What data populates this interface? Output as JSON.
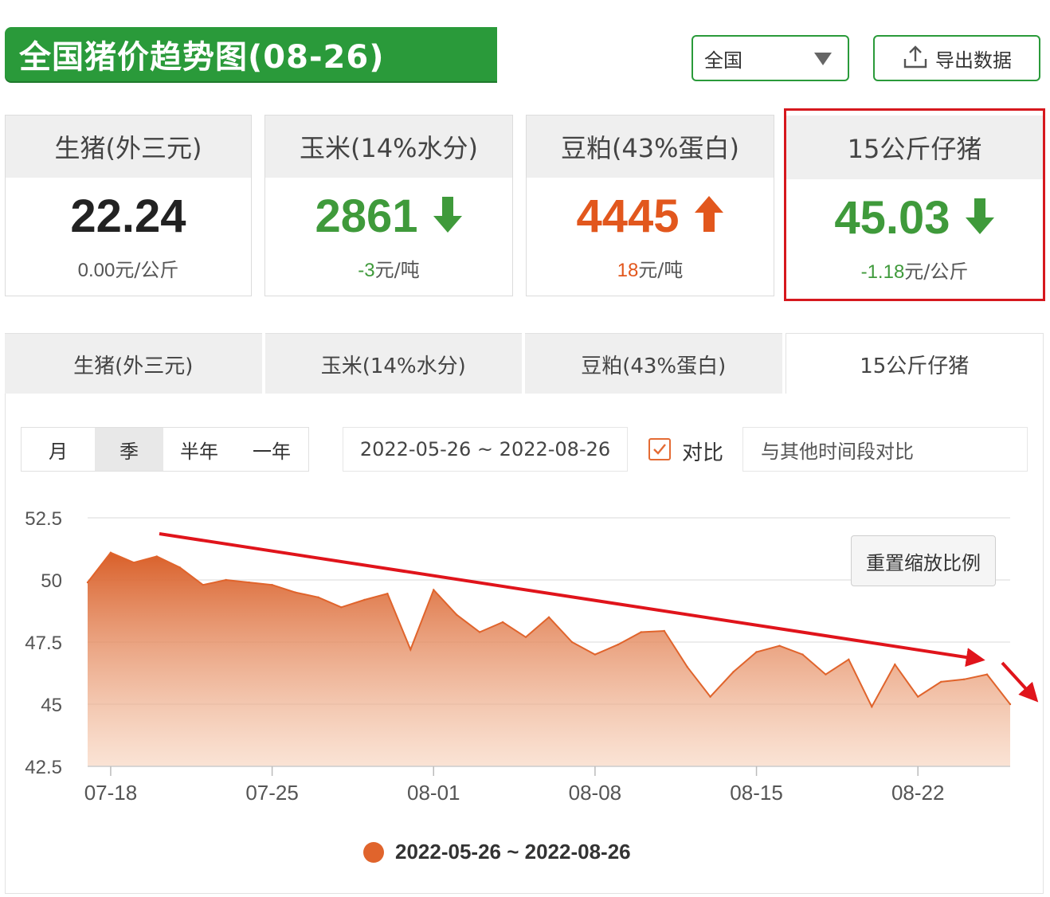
{
  "header": {
    "title": "全国猪价趋势图(08-26)",
    "region": "全国",
    "export_label": "导出数据"
  },
  "cards": [
    {
      "name": "生猪(外三元)",
      "price": "22.24",
      "change": "0.00",
      "unit": "元/公斤",
      "trend": "none",
      "color": "#222222"
    },
    {
      "name": "玉米(14%水分)",
      "price": "2861",
      "change": "-3",
      "unit": "元/吨",
      "trend": "down",
      "color": "#3f9a3b"
    },
    {
      "name": "豆粕(43%蛋白)",
      "price": "4445",
      "change": "18",
      "unit": "元/吨",
      "trend": "up",
      "color": "#e2571d"
    },
    {
      "name": "15公斤仔猪",
      "price": "45.03",
      "change": "-1.18",
      "unit": "元/公斤",
      "trend": "down",
      "color": "#3f9a3b"
    }
  ],
  "tabs": [
    {
      "label": "生猪(外三元)"
    },
    {
      "label": "玉米(14%水分)"
    },
    {
      "label": "豆粕(43%蛋白)"
    },
    {
      "label": "15公斤仔猪",
      "active": true
    }
  ],
  "toolbar": {
    "periods": [
      {
        "label": "月"
      },
      {
        "label": "季",
        "active": true
      },
      {
        "label": "半年"
      },
      {
        "label": "一年"
      }
    ],
    "date_range": "2022-05-26 ~ 2022-08-26",
    "compare_label": "对比",
    "compare_placeholder": "与其他时间段对比",
    "reset_zoom_label": "重置缩放比例"
  },
  "colors": {
    "brand_green": "#2a9a3a",
    "up": "#e2571d",
    "down": "#3f9a3b",
    "series": "#e0642c",
    "annotation": "#e0141b"
  },
  "chart_data": {
    "type": "area",
    "series": [
      {
        "name": "2022-05-26 ~ 2022-08-26",
        "points": [
          [
            "07-17",
            49.9
          ],
          [
            "07-18",
            51.1
          ],
          [
            "07-19",
            50.7
          ],
          [
            "07-20",
            50.95
          ],
          [
            "07-21",
            50.5
          ],
          [
            "07-22",
            49.8
          ],
          [
            "07-23",
            50.0
          ],
          [
            "07-24",
            49.9
          ],
          [
            "07-25",
            49.8
          ],
          [
            "07-26",
            49.5
          ],
          [
            "07-27",
            49.3
          ],
          [
            "07-28",
            48.9
          ],
          [
            "07-29",
            49.2
          ],
          [
            "07-30",
            49.45
          ],
          [
            "07-31",
            47.2
          ],
          [
            "08-01",
            49.6
          ],
          [
            "08-02",
            48.6
          ],
          [
            "08-03",
            47.9
          ],
          [
            "08-04",
            48.3
          ],
          [
            "08-05",
            47.7
          ],
          [
            "08-06",
            48.5
          ],
          [
            "08-07",
            47.5
          ],
          [
            "08-08",
            47.0
          ],
          [
            "08-09",
            47.4
          ],
          [
            "08-10",
            47.9
          ],
          [
            "08-11",
            47.95
          ],
          [
            "08-12",
            46.5
          ],
          [
            "08-13",
            45.3
          ],
          [
            "08-14",
            46.3
          ],
          [
            "08-15",
            47.1
          ],
          [
            "08-16",
            47.35
          ],
          [
            "08-17",
            47.0
          ],
          [
            "08-18",
            46.2
          ],
          [
            "08-19",
            46.8
          ],
          [
            "08-20",
            44.9
          ],
          [
            "08-21",
            46.6
          ],
          [
            "08-22",
            45.3
          ],
          [
            "08-23",
            45.9
          ],
          [
            "08-24",
            46.0
          ],
          [
            "08-25",
            46.2
          ],
          [
            "08-26",
            45.0
          ]
        ]
      }
    ],
    "xticks": [
      "07-18",
      "07-25",
      "08-01",
      "08-08",
      "08-15",
      "08-22"
    ],
    "yticks": [
      "42.5",
      "45",
      "47.5",
      "50",
      "52.5"
    ],
    "ylim": [
      42.5,
      52.5
    ],
    "grid": true,
    "legend": "bottom"
  }
}
